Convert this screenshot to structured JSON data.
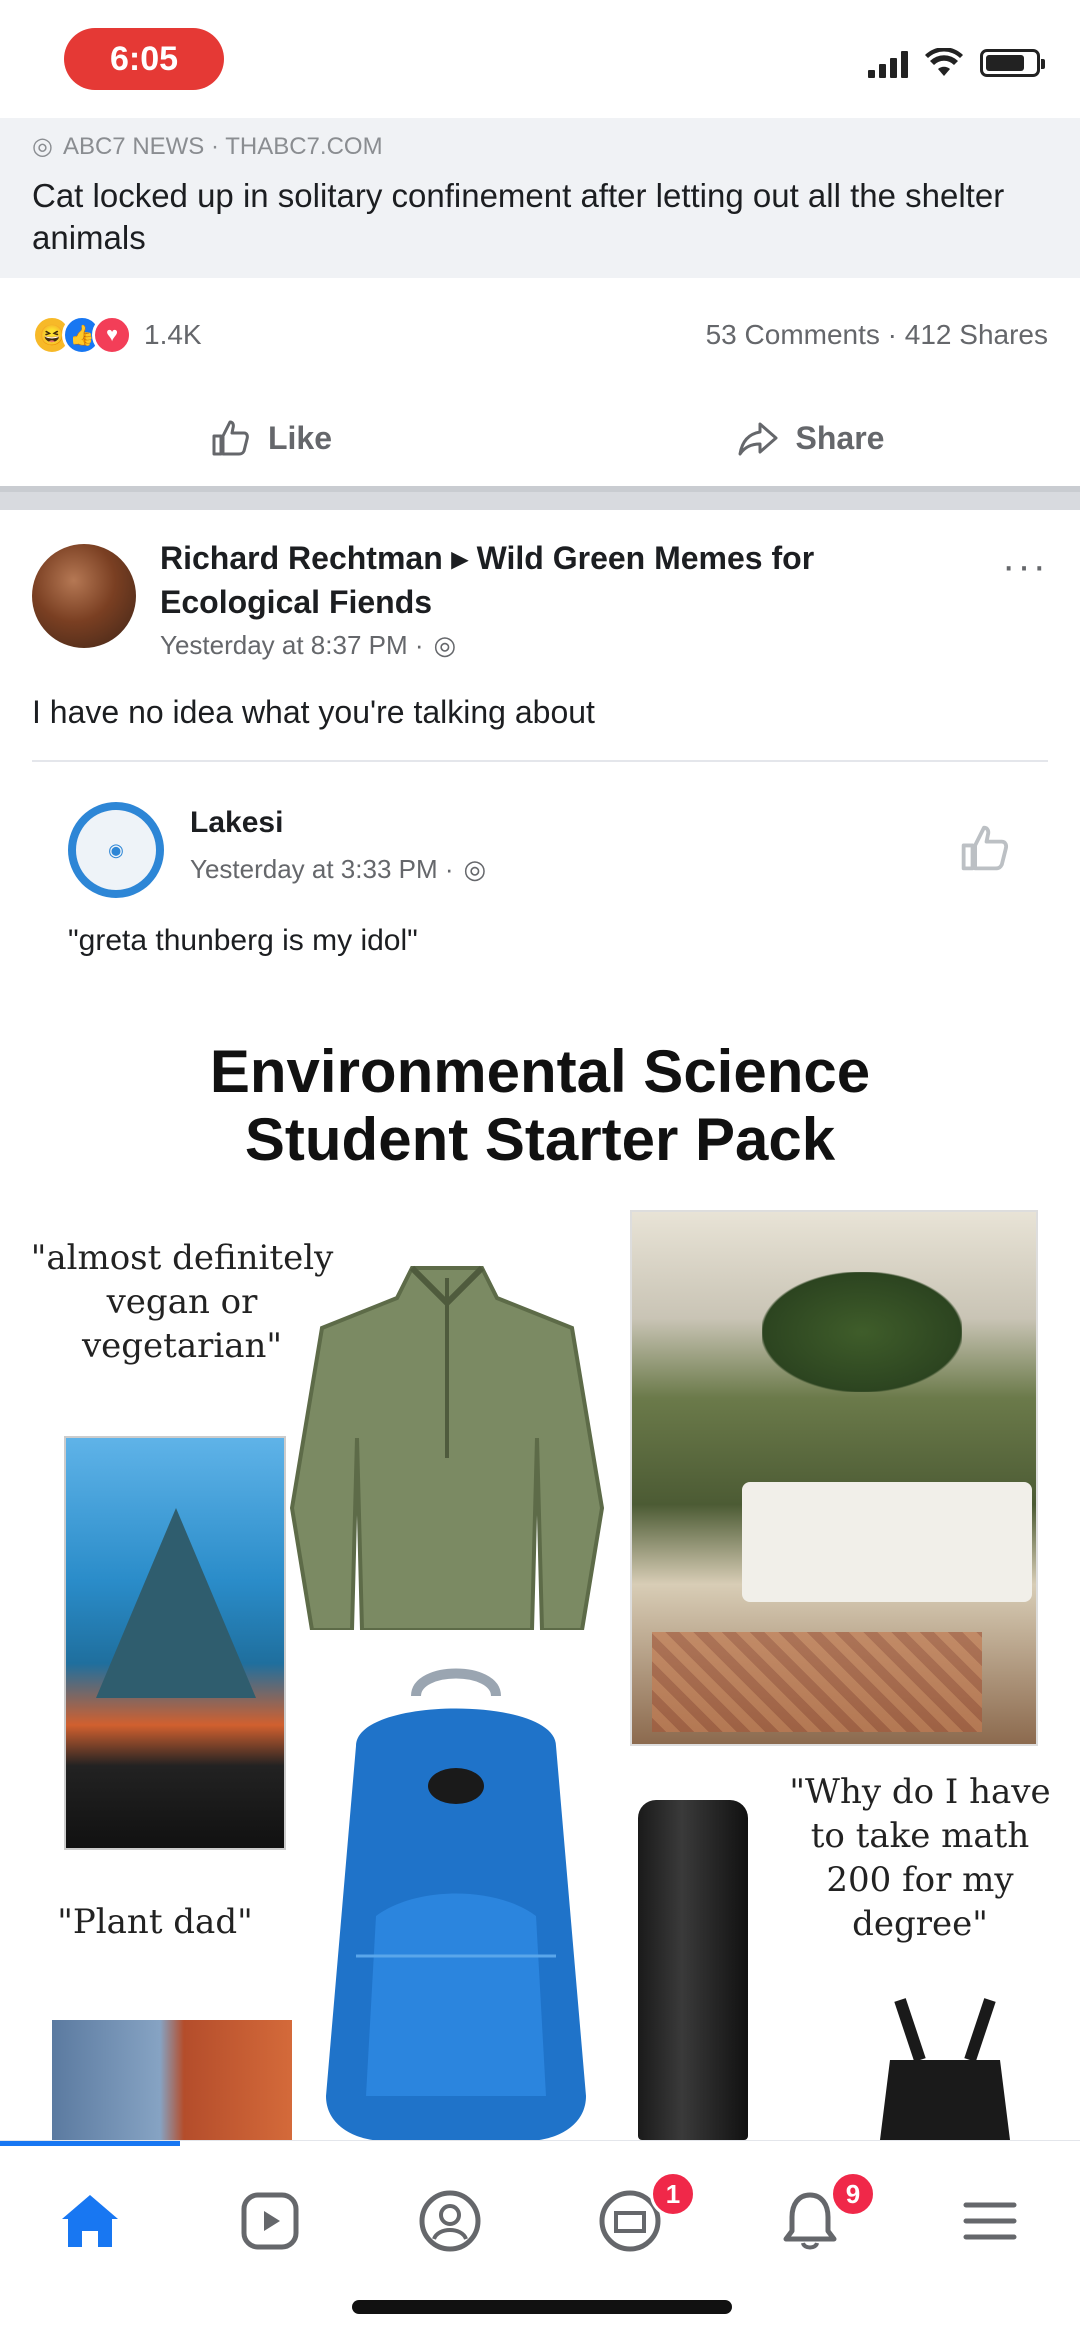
{
  "status_bar": {
    "time": "6:05"
  },
  "previous_post": {
    "meta": "ABC7 NEWS · THABC7.COM",
    "text": "Cat locked up in solitary confinement after letting out all the shelter animals"
  },
  "engagement": {
    "reactions_count": "1.4K",
    "comments_shares": "53 Comments · 412 Shares"
  },
  "actions": {
    "like_label": "Like",
    "share_label": "Share"
  },
  "post": {
    "author": "Richard Rechtman ▸ Wild Green Memes for Ecological Fiends",
    "time": "Yesterday at 8:37 PM ·",
    "text": "I have no idea what you're talking about",
    "more": "···"
  },
  "quoted": {
    "name": "Lakesi",
    "time": "Yesterday at 3:33 PM ·",
    "text": "\"greta thunberg is my idol\""
  },
  "meme": {
    "title_line1": "Environmental Science",
    "title_line2": "Student Starter Pack",
    "caption_vegan": "\"almost definitely vegan or vegetarian\"",
    "caption_plantdad": "\"Plant dad\"",
    "caption_math": "\"Why do I have to take math 200 for my degree\""
  },
  "nav": {
    "items": [
      {
        "name": "home"
      },
      {
        "name": "watch"
      },
      {
        "name": "profile"
      },
      {
        "name": "marketplace",
        "badge": "1"
      },
      {
        "name": "notifications",
        "badge": "9"
      },
      {
        "name": "menu"
      }
    ]
  },
  "colors": {
    "brand_blue": "#1877f2",
    "badge_red": "#f02849",
    "status_pill": "#e53935"
  }
}
